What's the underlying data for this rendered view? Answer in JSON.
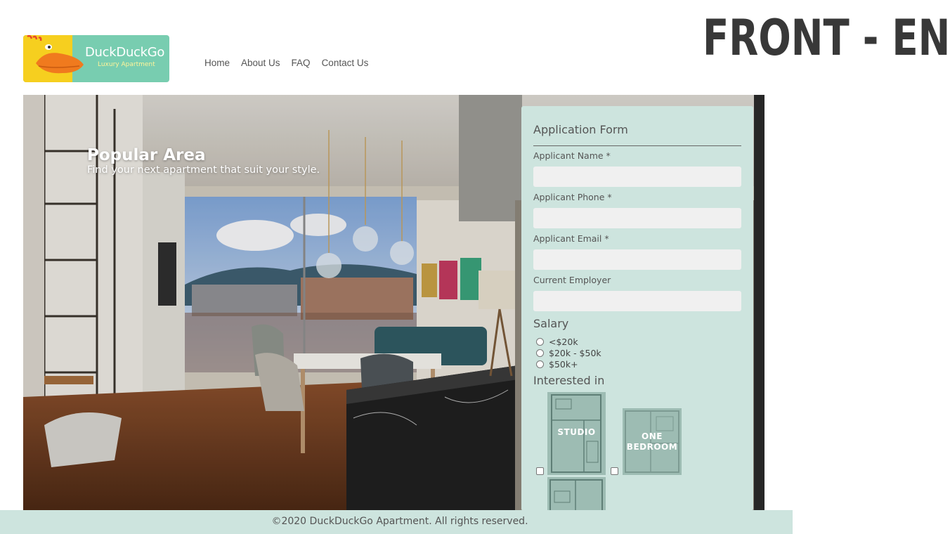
{
  "slide": {
    "title": "FRONT - END"
  },
  "brand": {
    "name": "DuckDuckGo",
    "tagline": "Luxury Apartment"
  },
  "nav": {
    "items": [
      "Home",
      "About Us",
      "FAQ",
      "Contact Us"
    ]
  },
  "hero": {
    "title": "Popular Area",
    "subtitle": "Find your next apartment that suit your style."
  },
  "form": {
    "title": "Application Form",
    "fields": [
      {
        "label": "Applicant Name *",
        "value": ""
      },
      {
        "label": "Applicant Phone *",
        "value": ""
      },
      {
        "label": "Applicant Email *",
        "value": ""
      },
      {
        "label": "Current Employer",
        "value": ""
      }
    ],
    "salary": {
      "heading": "Salary",
      "options": [
        "<$20k",
        "$20k - $50k",
        "$50k+"
      ]
    },
    "interest": {
      "heading": "Interested in",
      "plans": [
        "STUDIO",
        "ONE BEDROOM"
      ]
    }
  },
  "footer": {
    "text": "©2020 DuckDuckGo Apartment. All rights reserved."
  },
  "colors": {
    "accent": "#cde4de",
    "logo_bg": "#78cdb0",
    "duck_yellow": "#f6cf1f",
    "duck_beak": "#f07a1e"
  }
}
